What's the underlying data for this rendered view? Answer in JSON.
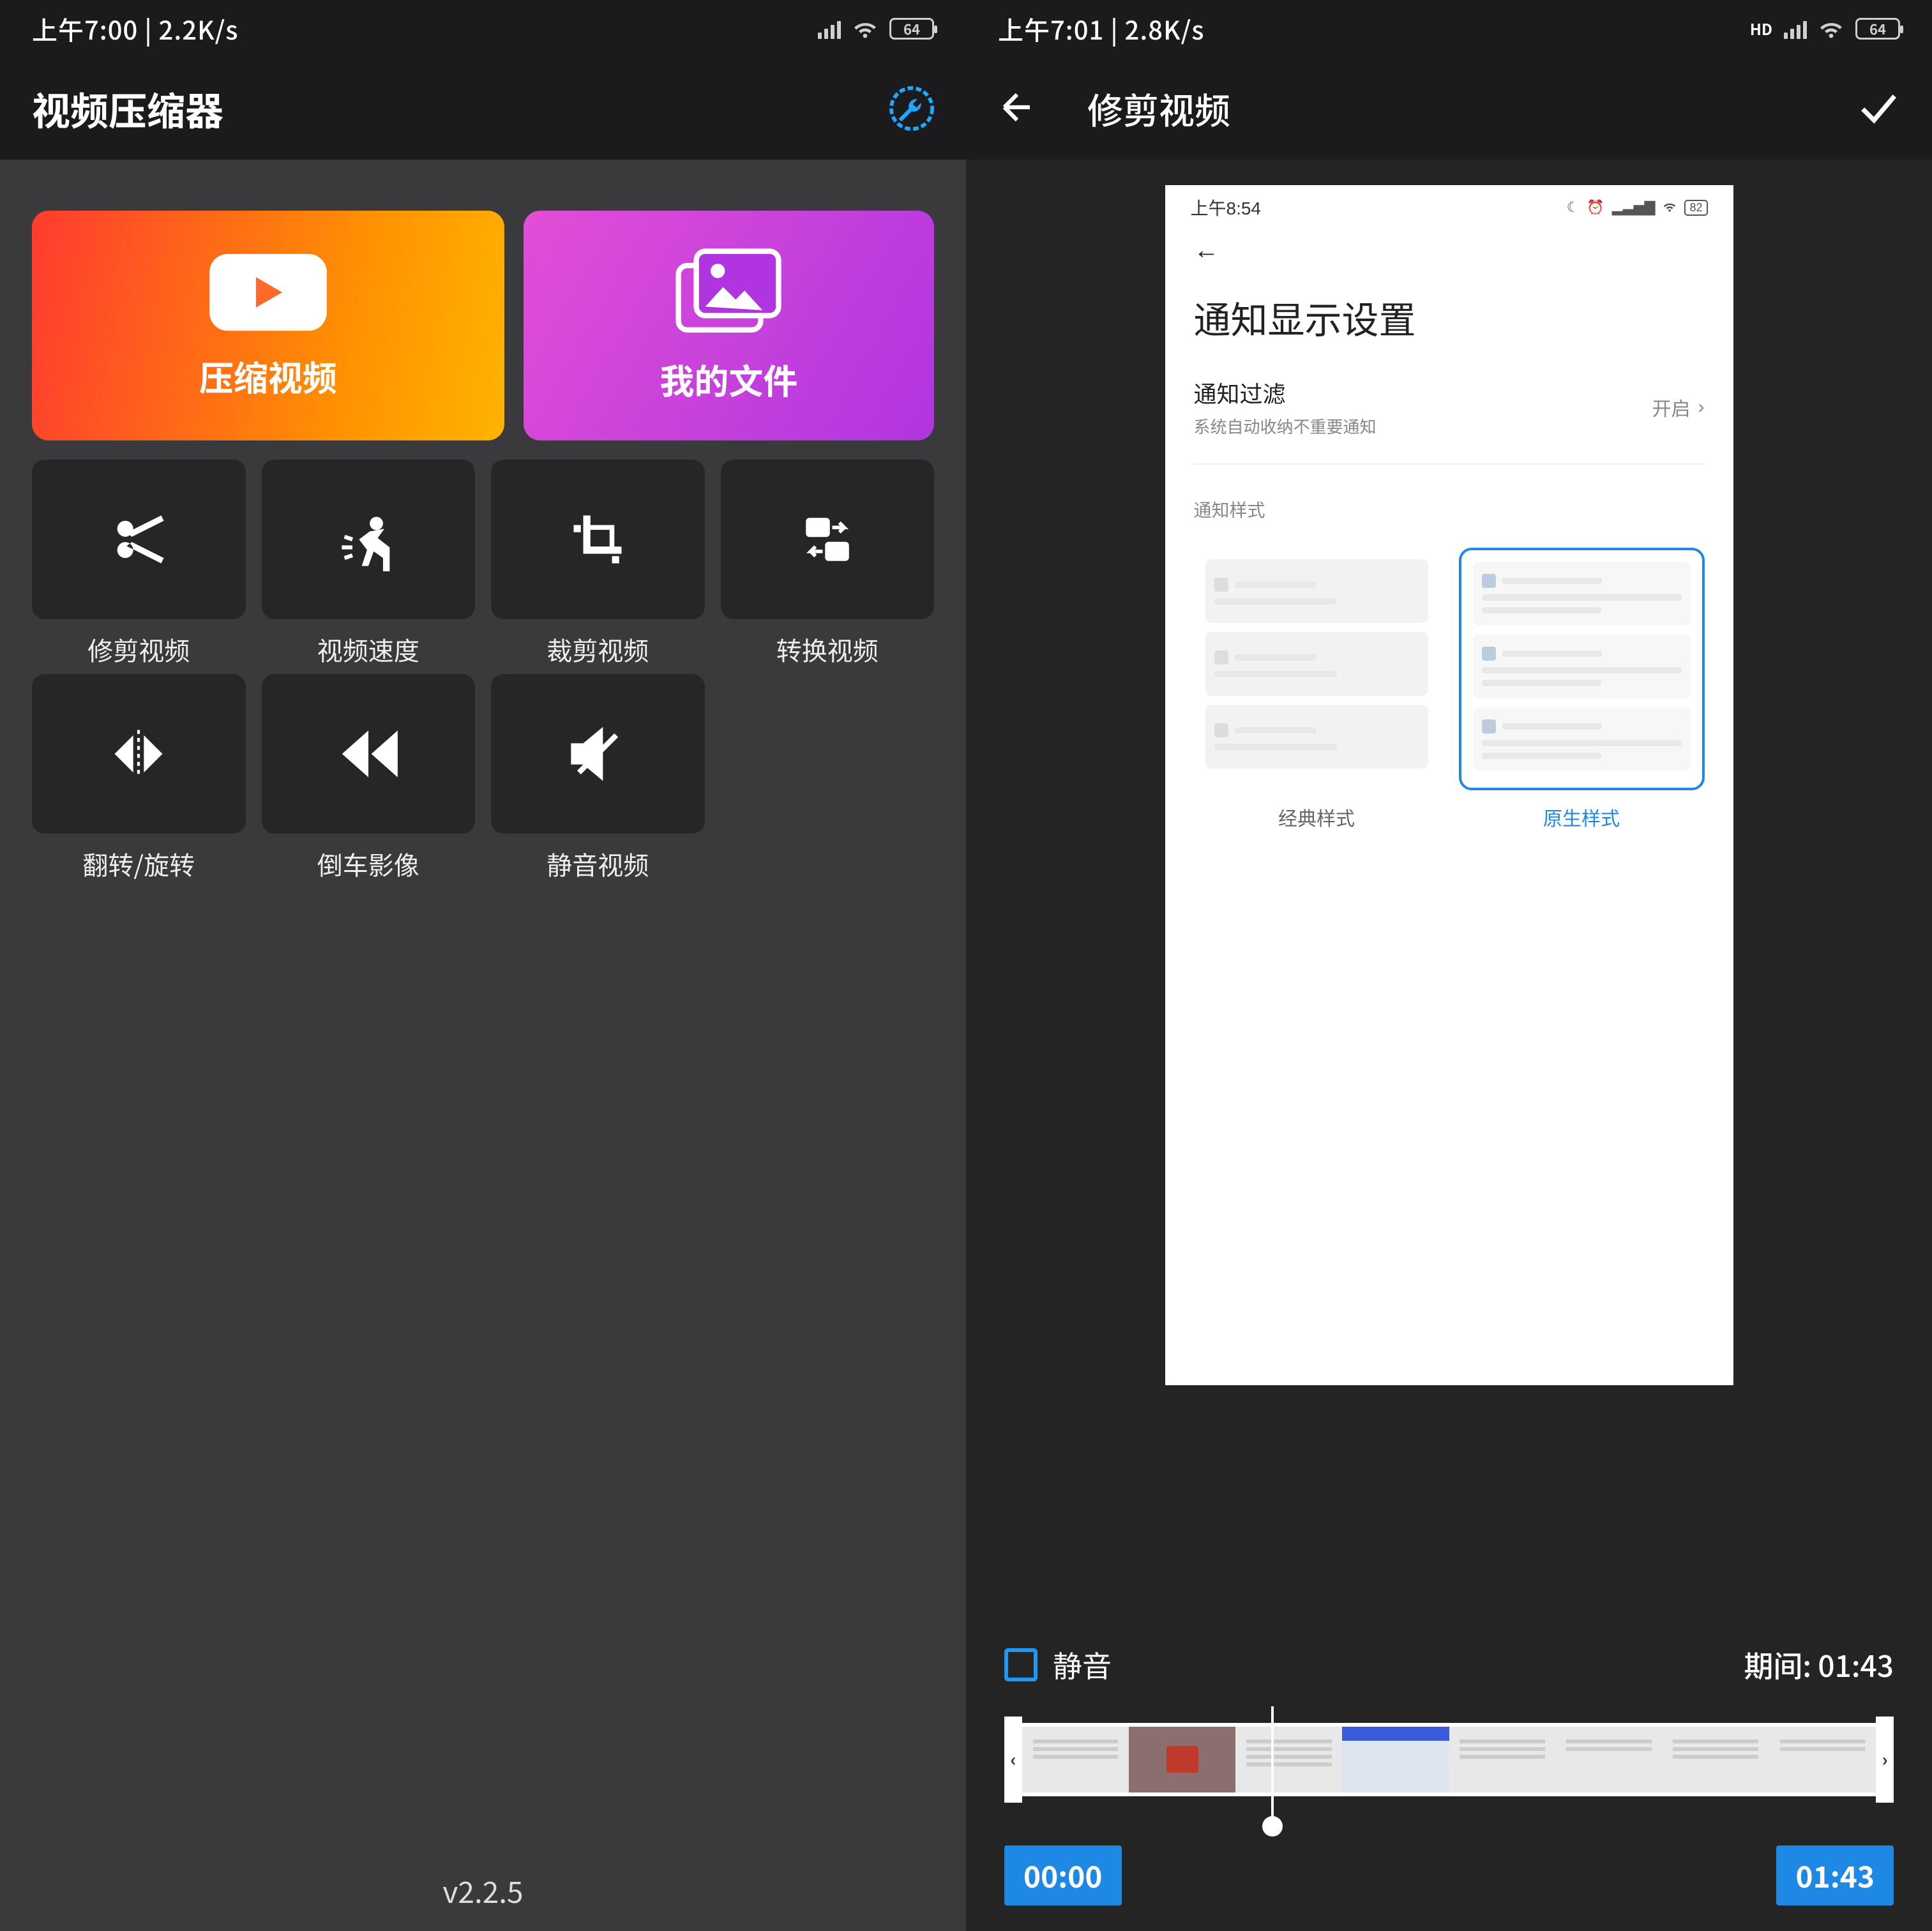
{
  "left": {
    "status": {
      "time": "上午7:00 | 2.2K/s",
      "battery": "64"
    },
    "appbar": {
      "title": "视频压缩器"
    },
    "big_cards": {
      "compress": "压缩视频",
      "files": "我的文件"
    },
    "small_cards": [
      "修剪视频",
      "视频速度",
      "裁剪视频",
      "转换视频",
      "翻转/旋转",
      "倒车影像",
      "静音视频"
    ],
    "version": "v2.2.5"
  },
  "right": {
    "status": {
      "time": "上午7:01 | 2.8K/s",
      "battery": "64"
    },
    "appbar": {
      "title": "修剪视频"
    },
    "preview": {
      "status_time": "上午8:54",
      "status_battery": "82",
      "title": "通知显示设置",
      "row": {
        "title": "通知过滤",
        "sub": "系统自动收纳不重要通知",
        "value": "开启"
      },
      "section_label": "通知样式",
      "styles": {
        "classic": "经典样式",
        "native": "原生样式"
      }
    },
    "controls": {
      "mute": "静音",
      "duration_label": "期间:",
      "duration_value": "01:43",
      "start": "00:00",
      "end": "01:43"
    }
  }
}
